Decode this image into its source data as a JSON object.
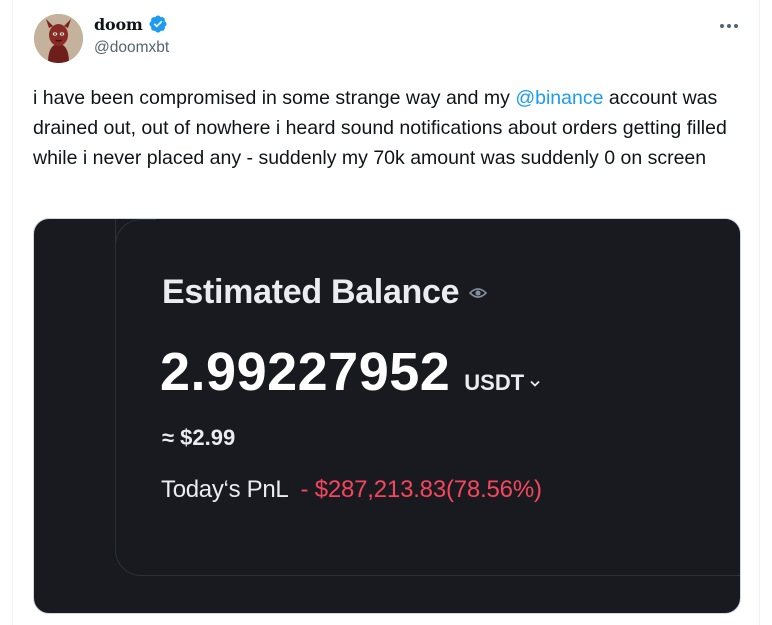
{
  "author": {
    "display_name": "doom",
    "handle": "@doomxbt",
    "verified": true
  },
  "tweet": {
    "text_before_mention": "i have been compromised in some strange way and my ",
    "mention": "@binance",
    "text_after_mention": " account was drained out, out of nowhere i heard sound notifications about orders getting filled while i never placed any - suddenly my 70k amount was suddenly 0 on screen"
  },
  "media": {
    "estimated_balance_label": "Estimated Balance",
    "balance_value": "2.99227952",
    "unit": "USDT",
    "approx_value": "≈ $2.99",
    "pnl_label": "Today‘s PnL",
    "pnl_value": "- $287,213.83(78.56%)"
  },
  "icons": {
    "verified": "verified-badge-icon",
    "more": "more-options-icon",
    "eye": "eye-icon",
    "chevron": "chevron-down-icon"
  },
  "colors": {
    "accent": "#1d9bf0",
    "media_bg": "#181a20",
    "negative": "#f6465d"
  }
}
